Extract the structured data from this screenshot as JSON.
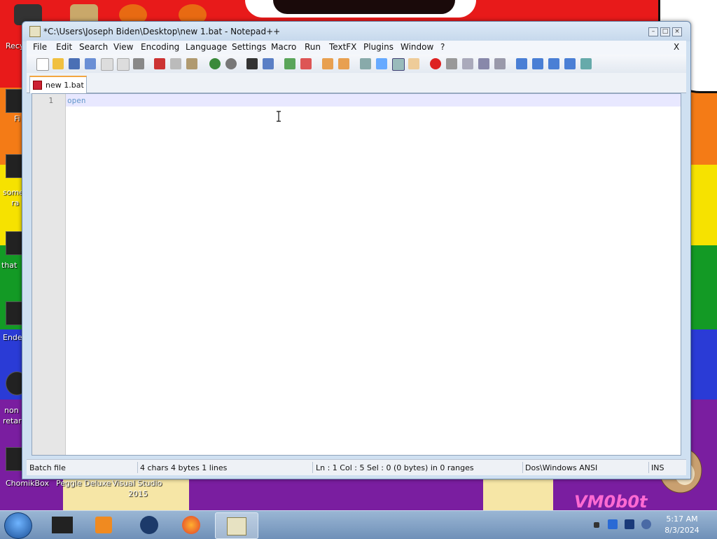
{
  "window": {
    "title": "*C:\\Users\\Joseph Biden\\Desktop\\new  1.bat - Notepad++",
    "close_x": "X"
  },
  "menu": [
    "File",
    "Edit",
    "Search",
    "View",
    "Encoding",
    "Language",
    "Settings",
    "Macro",
    "Run",
    "TextFX",
    "Plugins",
    "Window",
    "?"
  ],
  "tab": {
    "label": "new  1.bat"
  },
  "editor": {
    "line_number": "1",
    "content": "open"
  },
  "status": {
    "filetype": "Batch file",
    "length": "4 chars  4 bytes  1 lines",
    "position": "Ln : 1    Col : 5    Sel : 0 (0 bytes) in 0 ranges",
    "eol_encoding": "Dos\\Windows  ANSI",
    "mode": "INS"
  },
  "desktop": {
    "labels": [
      "Recy",
      "Fi",
      "some",
      "ra",
      "that",
      "Ende",
      "non",
      "retar",
      "ChomikBox",
      "Peggle Deluxe",
      "Visual Studio",
      "2015"
    ],
    "watermark": "VM0b0t"
  },
  "taskbar": {
    "time": "5:17 AM",
    "date": "8/3/2024"
  },
  "colors": {
    "accent": "#f3a640",
    "titlebar": "#c6d8ec",
    "code_text": "#6699cc"
  }
}
